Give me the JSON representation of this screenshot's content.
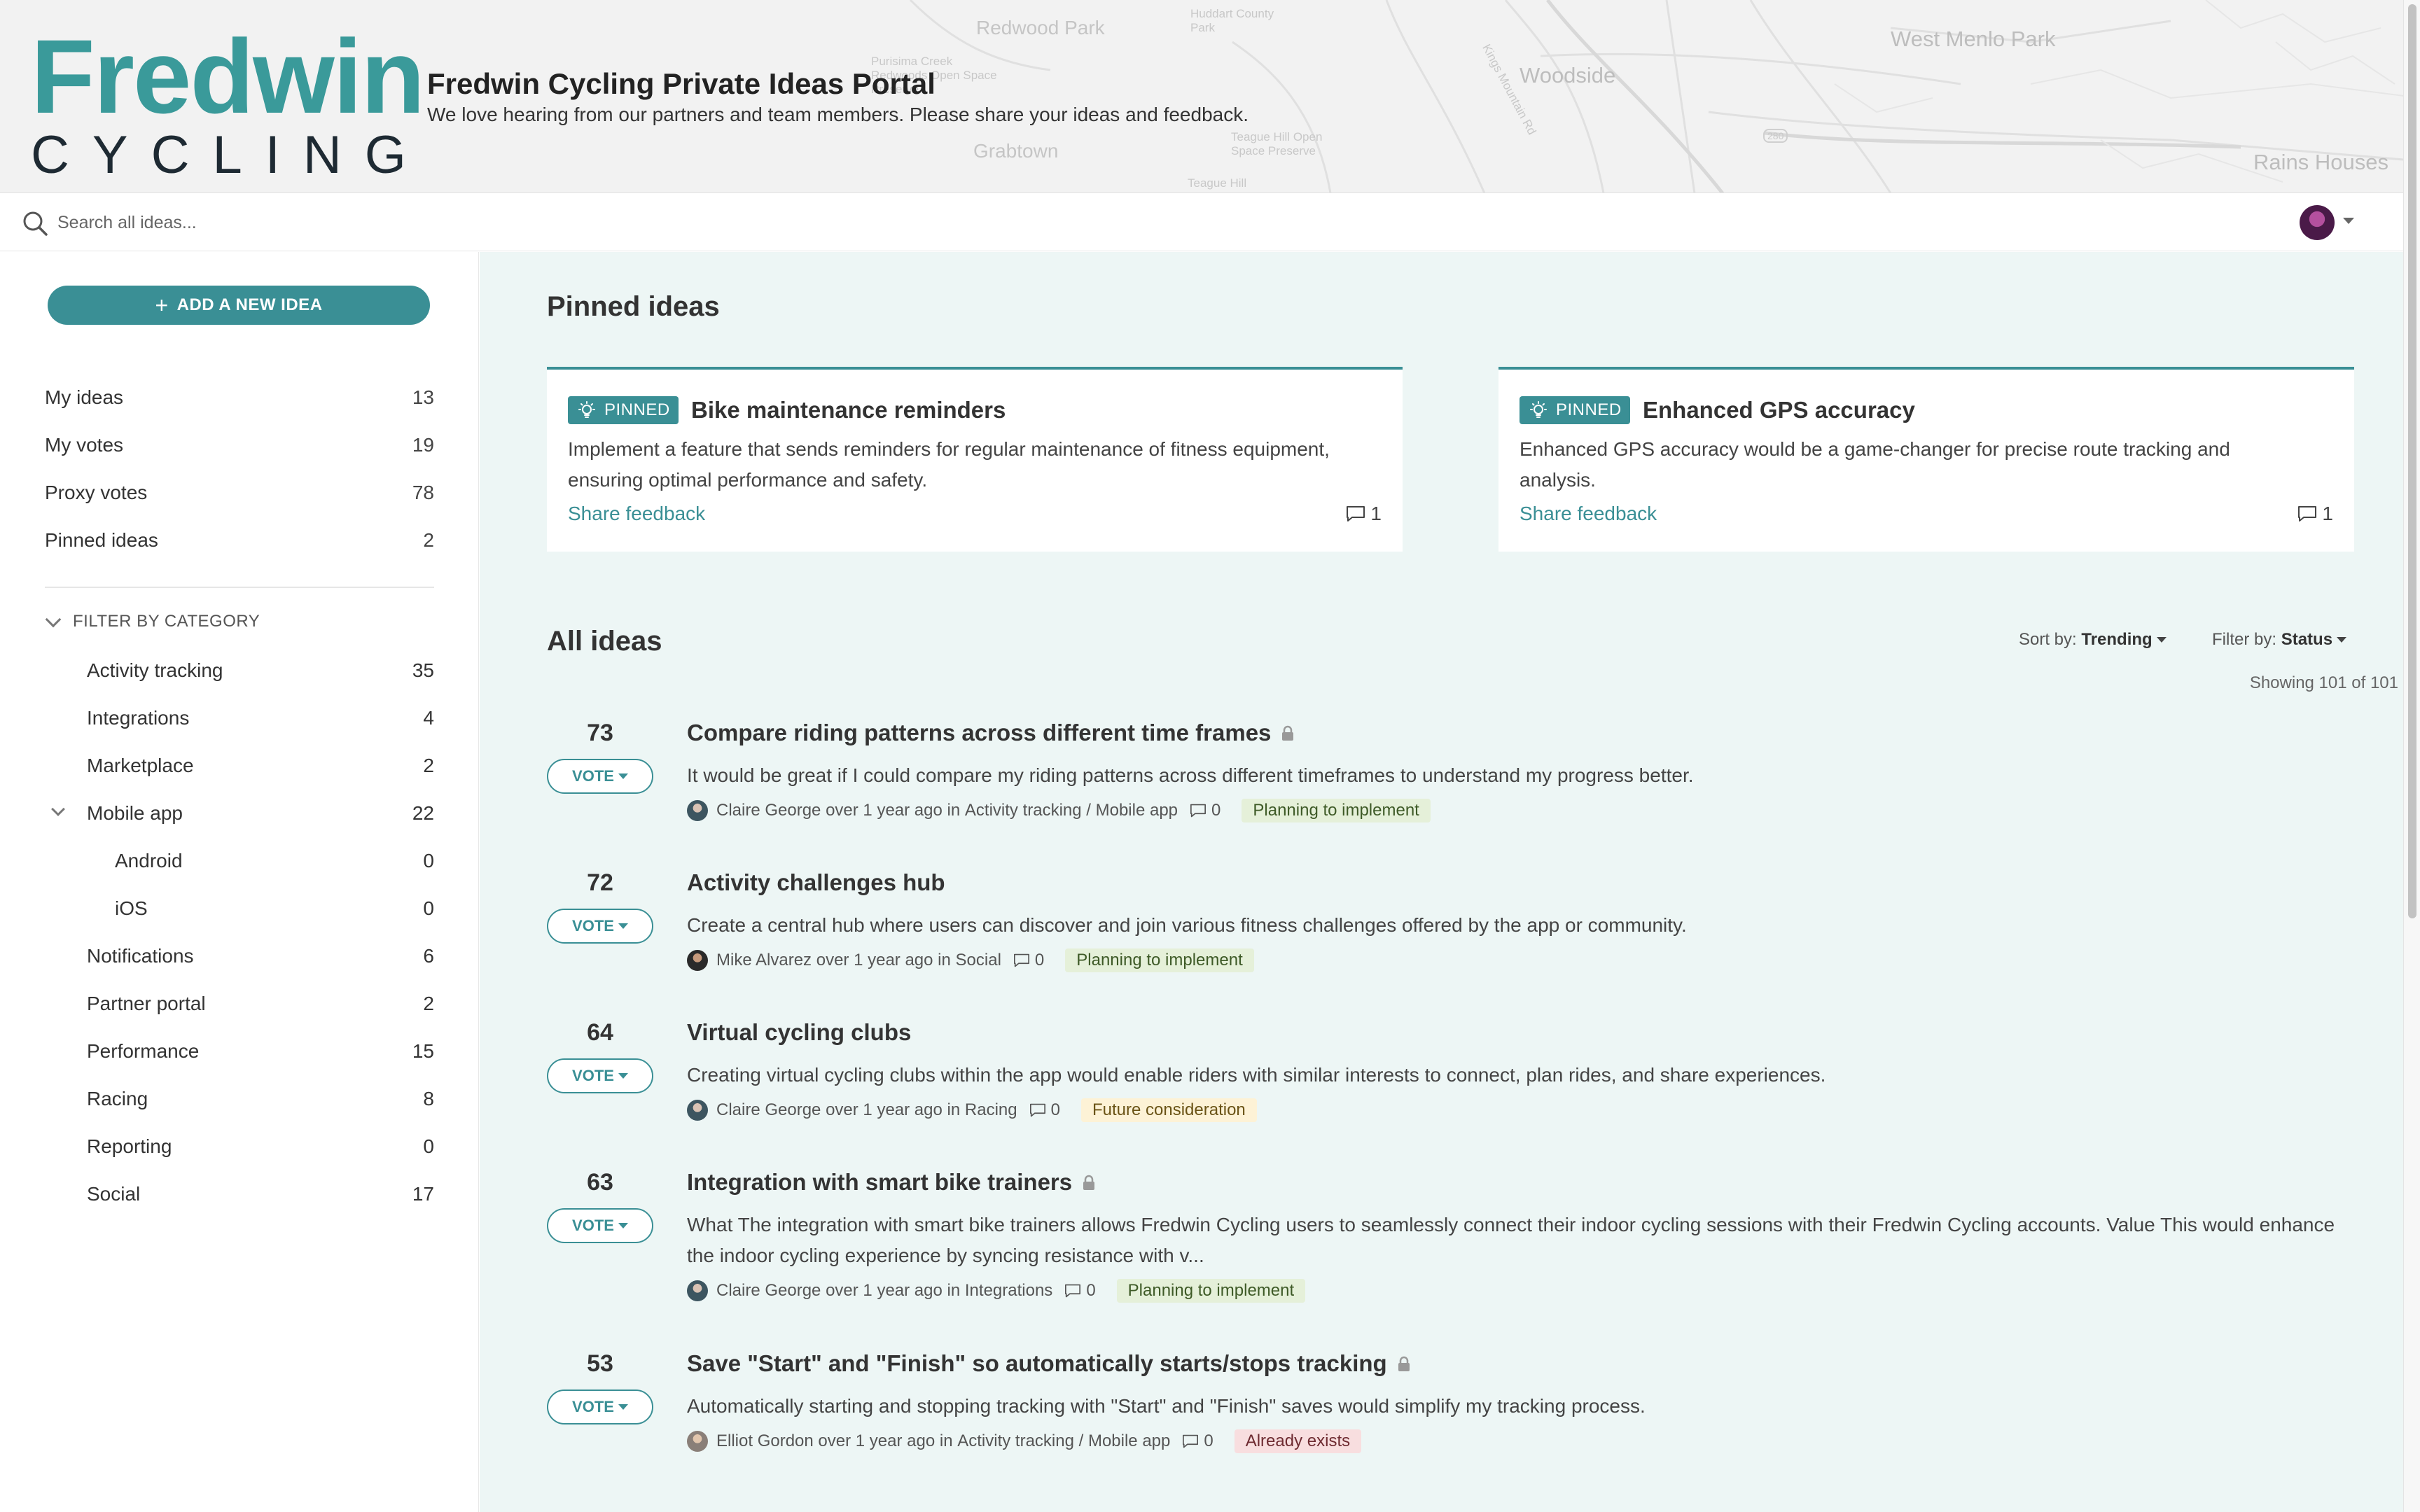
{
  "header": {
    "logo_top": "Fredwin",
    "logo_bottom": "CYCLING",
    "portal_title": "Fredwin Cycling Private Ideas Portal",
    "portal_subtitle": "We love hearing from our partners and team members. Please share your ideas and feedback.",
    "map_labels": {
      "redwood_park": "Redwood Park",
      "huddart": "Huddart County Park",
      "purisima": "Purisima Creek Redwoods Open Space Preserve",
      "woodside": "Woodside",
      "west_menlo": "West Menlo Park",
      "grabtown": "Grabtown",
      "teague_hill_os": "Teague Hill Open Space Preserve",
      "teague_hill": "Teague Hill",
      "rains_houses": "Rains Houses",
      "kings_mountain": "Kings Mountain Rd",
      "route_280": "280"
    }
  },
  "search": {
    "placeholder": "Search all ideas..."
  },
  "sidebar": {
    "add_label": "ADD A NEW IDEA",
    "nav": [
      {
        "label": "My ideas",
        "count": "13"
      },
      {
        "label": "My votes",
        "count": "19"
      },
      {
        "label": "Proxy votes",
        "count": "78"
      },
      {
        "label": "Pinned ideas",
        "count": "2"
      }
    ],
    "filter_title": "FILTER BY CATEGORY",
    "categories": [
      {
        "label": "Activity tracking",
        "count": "35"
      },
      {
        "label": "Integrations",
        "count": "4"
      },
      {
        "label": "Marketplace",
        "count": "2"
      },
      {
        "label": "Mobile app",
        "count": "22"
      },
      {
        "label": "Android",
        "count": "0"
      },
      {
        "label": "iOS",
        "count": "0"
      },
      {
        "label": "Notifications",
        "count": "6"
      },
      {
        "label": "Partner portal",
        "count": "2"
      },
      {
        "label": "Performance",
        "count": "15"
      },
      {
        "label": "Racing",
        "count": "8"
      },
      {
        "label": "Reporting",
        "count": "0"
      },
      {
        "label": "Social",
        "count": "17"
      }
    ]
  },
  "main": {
    "pinned_heading": "Pinned ideas",
    "pinned": [
      {
        "badge": "PINNED",
        "title": "Bike maintenance reminders",
        "description": "Implement a feature that sends reminders for regular maintenance of fitness equipment, ensuring optimal performance and safety.",
        "share": "Share feedback",
        "comments": "1"
      },
      {
        "badge": "PINNED",
        "title": "Enhanced GPS accuracy",
        "description": "Enhanced GPS accuracy would be a game-changer for precise route tracking and analysis.",
        "share": "Share feedback",
        "comments": "1"
      }
    ],
    "all_heading": "All ideas",
    "sort_label": "Sort by:",
    "sort_value": "Trending",
    "filter_label": "Filter by:",
    "filter_value": "Status",
    "showing": "Showing 101 of 101",
    "vote_label": "VOTE",
    "ideas": [
      {
        "votes": "73",
        "title": "Compare riding patterns across different time frames",
        "locked": true,
        "description": "It would be great if I could compare my riding patterns across different timeframes to understand my progress better.",
        "author": "Claire George",
        "when": "over 1 year ago",
        "in_word": "in",
        "category": "Activity tracking / Mobile app",
        "comments": "0",
        "status": "Planning to implement"
      },
      {
        "votes": "72",
        "title": "Activity challenges hub",
        "locked": false,
        "description": "Create a central hub where users can discover and join various fitness challenges offered by the app or community.",
        "author": "Mike Alvarez",
        "when": "over 1 year ago",
        "in_word": "in",
        "category": "Social",
        "comments": "0",
        "status": "Planning to implement"
      },
      {
        "votes": "64",
        "title": "Virtual cycling clubs",
        "locked": false,
        "description": "Creating virtual cycling clubs within the app would enable riders with similar interests to connect, plan rides, and share experiences.",
        "author": "Claire George",
        "when": "over 1 year ago",
        "in_word": "in",
        "category": "Racing",
        "comments": "0",
        "status": "Future consideration"
      },
      {
        "votes": "63",
        "title": "Integration with smart bike trainers",
        "locked": true,
        "description": "What The integration with smart bike trainers allows Fredwin Cycling users to seamlessly connect their indoor cycling sessions with their Fredwin Cycling accounts. Value This would enhance the indoor cycling experience by syncing resistance with v...",
        "author": "Claire George",
        "when": "over 1 year ago",
        "in_word": "in",
        "category": "Integrations",
        "comments": "0",
        "status": "Planning to implement"
      },
      {
        "votes": "53",
        "title": "Save \"Start\" and \"Finish\" so automatically starts/stops tracking",
        "locked": true,
        "description": "Automatically starting and stopping tracking with \"Start\" and \"Finish\" saves would simplify my tracking process.",
        "author": "Elliot Gordon",
        "when": "over 1 year ago",
        "in_word": "in",
        "category": "Activity tracking / Mobile app",
        "comments": "0",
        "status": "Already exists"
      }
    ]
  },
  "colors": {
    "accent": "#3a8f95",
    "logo_teal": "#3a9a9a",
    "main_bg": "#edf6f5",
    "status_planning": "#e5f0d9",
    "status_future": "#fdf2d6",
    "status_exists": "#f8dedf"
  },
  "icons": [
    "search-icon",
    "plus-icon",
    "chevron-down-icon",
    "lightbulb-icon",
    "comment-icon",
    "lock-icon",
    "caret-down-icon",
    "avatar"
  ]
}
